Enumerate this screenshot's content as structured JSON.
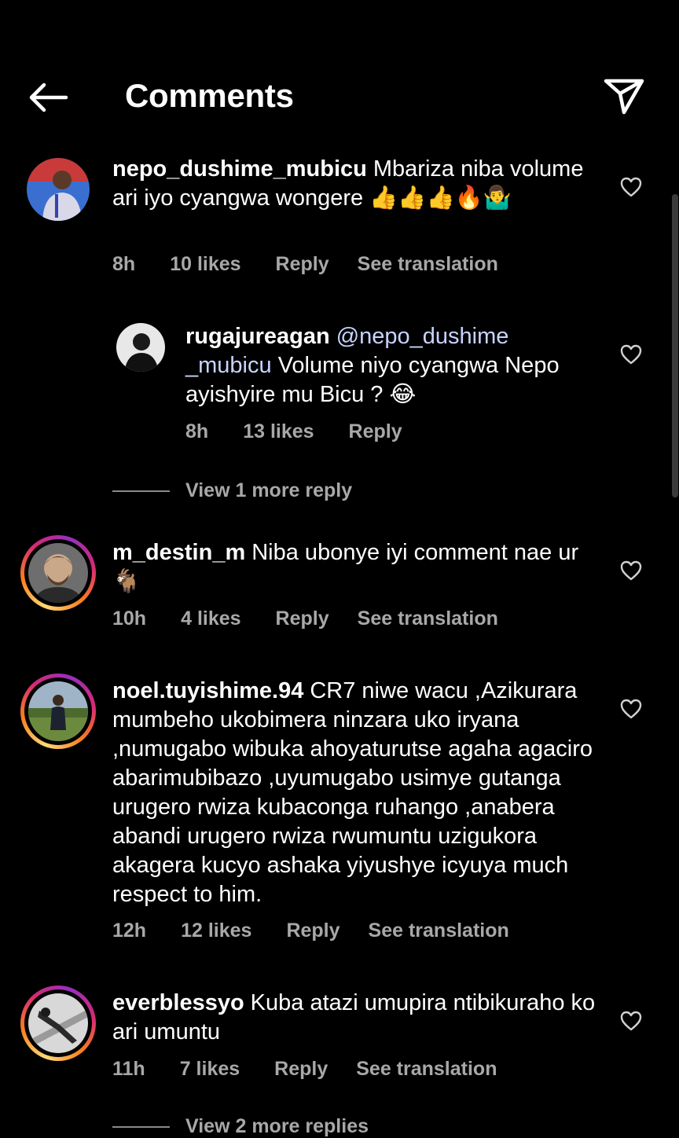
{
  "header": {
    "title": "Comments"
  },
  "comments": [
    {
      "username": "nepo_dushime_mubicu",
      "text": "Mbariza niba volume ari iyo cyangwa wongere 👍👍👍🔥🤷‍♂️",
      "time": "8h",
      "likes": "10 likes",
      "reply": "Reply",
      "translation": "See translation",
      "reply_item": {
        "username": "rugajureagan",
        "mention": "@nepo_dushime _mubicu",
        "text": "Volume niyo cyangwa Nepo ayishyire mu Bicu ? 😂",
        "time": "8h",
        "likes": "13 likes",
        "reply": "Reply"
      },
      "view_more": "View 1 more reply"
    },
    {
      "username": "m_destin_m",
      "text": "Niba ubonye iyi comment nae ur 🐐",
      "time": "10h",
      "likes": "4 likes",
      "reply": "Reply",
      "translation": "See translation"
    },
    {
      "username": "noel.tuyishime.94",
      "text": "CR7 niwe wacu ,Azikurara mumbeho ukobimera ninzara uko iryana ,numugabo wibuka ahoyaturutse agaha agaciro abarimubibazo ,uyumugabo usimye gutanga urugero rwiza kubaconga ruhango ,anabera abandi urugero rwiza rwumuntu uzigukora akagera kucyo ashaka yiyushye icyuya much respect to him.",
      "time": "12h",
      "likes": "12 likes",
      "reply": "Reply",
      "translation": "See translation"
    },
    {
      "username": "everblessyo",
      "text": "Kuba atazi umupira ntibikuraho ko ari umuntu",
      "time": "11h",
      "likes": "7 likes",
      "reply": "Reply",
      "translation": "See translation",
      "view_more": "View 2 more replies"
    }
  ],
  "icons": {
    "back": "arrow-left-icon",
    "share": "send-icon",
    "like": "heart-icon"
  }
}
